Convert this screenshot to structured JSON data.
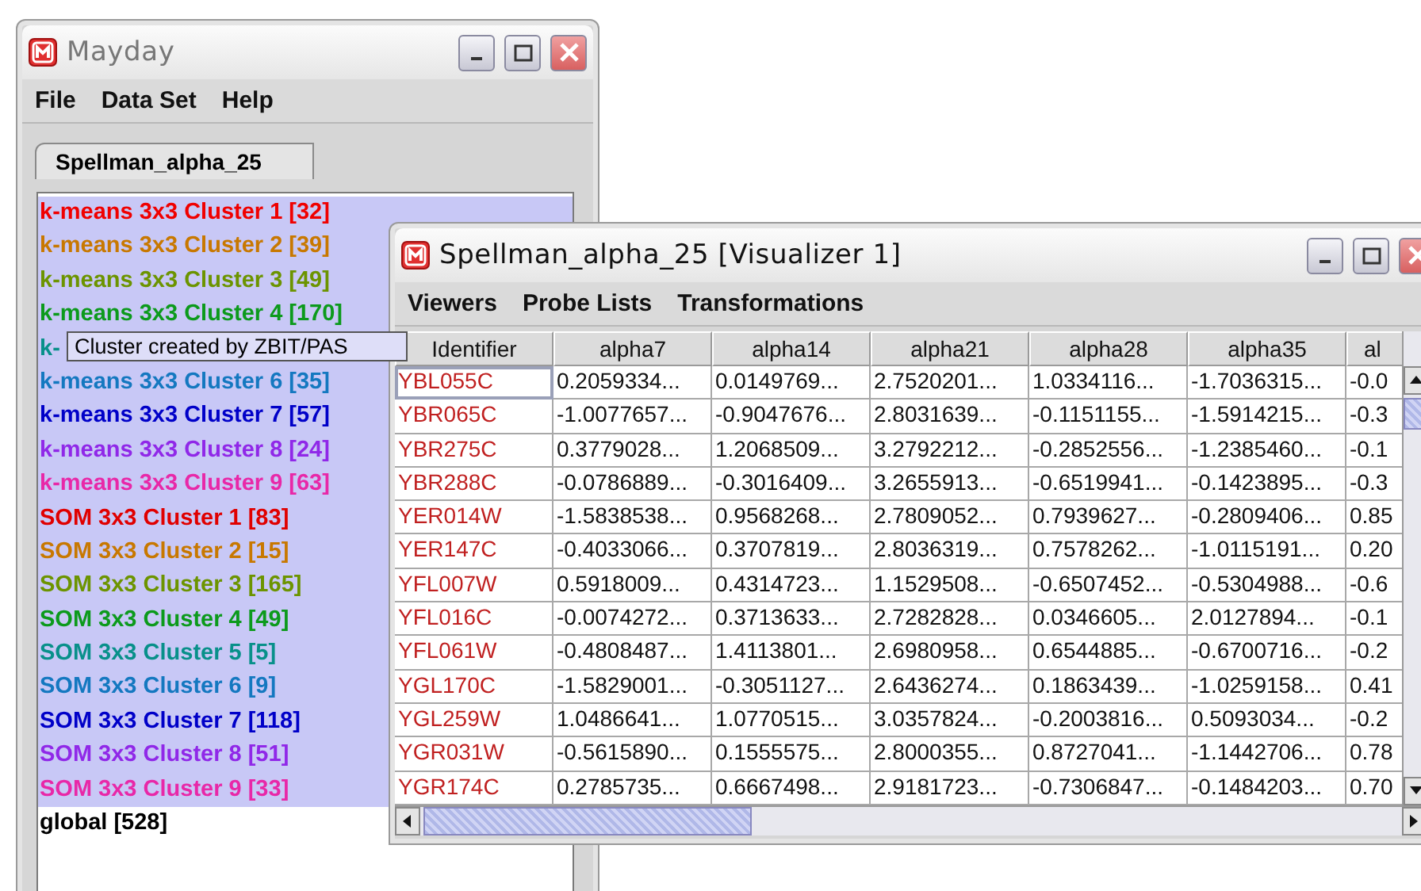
{
  "main_window": {
    "title": "Mayday",
    "active": false,
    "menu": [
      "File",
      "Data Set",
      "Help"
    ],
    "tabs": [
      {
        "label": "Spellman_alpha_25",
        "selected": true
      }
    ],
    "clusters": [
      {
        "label": "k-means 3x3 Cluster 1 [32]",
        "color": "#f00000",
        "selected": true
      },
      {
        "label": "k-means 3x3 Cluster 2 [39]",
        "color": "#c87800",
        "selected": true
      },
      {
        "label": "k-means 3x3 Cluster 3 [49]",
        "color": "#6c9400",
        "selected": true
      },
      {
        "label": "k-means 3x3 Cluster 4 [170]",
        "color": "#0c9a1c",
        "selected": true
      },
      {
        "label": "k-",
        "color": "#08908a",
        "selected": true,
        "tooltip": "Cluster created by ZBIT/PAS"
      },
      {
        "label": "k-means 3x3 Cluster 6 [35]",
        "color": "#1478c0",
        "selected": true
      },
      {
        "label": "k-means 3x3 Cluster 7 [57]",
        "color": "#0000c8",
        "selected": true
      },
      {
        "label": "k-means 3x3 Cluster 8 [24]",
        "color": "#9028e8",
        "selected": true
      },
      {
        "label": "k-means 3x3 Cluster 9 [63]",
        "color": "#e828a8",
        "selected": true
      },
      {
        "label": "SOM 3x3 Cluster 1 [83]",
        "color": "#e00000",
        "selected": true
      },
      {
        "label": "SOM 3x3 Cluster 2 [15]",
        "color": "#c87800",
        "selected": true
      },
      {
        "label": "SOM 3x3 Cluster 3 [165]",
        "color": "#6c9400",
        "selected": true
      },
      {
        "label": "SOM 3x3 Cluster 4 [49]",
        "color": "#0c9a1c",
        "selected": true
      },
      {
        "label": "SOM 3x3 Cluster 5 [5]",
        "color": "#08908a",
        "selected": true
      },
      {
        "label": "SOM 3x3 Cluster 6 [9]",
        "color": "#1478c0",
        "selected": true
      },
      {
        "label": "SOM 3x3 Cluster 7 [118]",
        "color": "#0000c8",
        "selected": true
      },
      {
        "label": "SOM 3x3 Cluster 8 [51]",
        "color": "#9028e8",
        "selected": true
      },
      {
        "label": "SOM 3x3 Cluster 9 [33]",
        "color": "#e828a8",
        "selected": true
      },
      {
        "label": "global [528]",
        "color": "#000000",
        "selected": false
      }
    ]
  },
  "visualizer": {
    "title": "Spellman_alpha_25 [Visualizer 1]",
    "active": true,
    "menu": [
      "Viewers",
      "Probe Lists",
      "Transformations"
    ],
    "columns": [
      "Identifier",
      "alpha7",
      "alpha14",
      "alpha21",
      "alpha28",
      "alpha35",
      "al"
    ],
    "rows": [
      {
        "id": "YBL055C",
        "focused": true,
        "values": [
          "0.2059334...",
          "0.0149769...",
          "2.7520201...",
          "1.0334116...",
          "-1.7036315...",
          "-0.0"
        ]
      },
      {
        "id": "YBR065C",
        "focused": false,
        "values": [
          "-1.0077657...",
          "-0.9047676...",
          "2.8031639...",
          "-0.1151155...",
          "-1.5914215...",
          "-0.3"
        ]
      },
      {
        "id": "YBR275C",
        "focused": false,
        "values": [
          "0.3779028...",
          "1.2068509...",
          "3.2792212...",
          "-0.2852556...",
          "-1.2385460...",
          "-0.1"
        ]
      },
      {
        "id": "YBR288C",
        "focused": false,
        "values": [
          "-0.0786889...",
          "-0.3016409...",
          "3.2655913...",
          "-0.6519941...",
          "-0.1423895...",
          "-0.3"
        ]
      },
      {
        "id": "YER014W",
        "focused": false,
        "values": [
          "-1.5838538...",
          "0.9568268...",
          "2.7809052...",
          "0.7939627...",
          "-0.2809406...",
          "0.85"
        ]
      },
      {
        "id": "YER147C",
        "focused": false,
        "values": [
          "-0.4033066...",
          "0.3707819...",
          "2.8036319...",
          "0.7578262...",
          "-1.0115191...",
          "0.20"
        ]
      },
      {
        "id": "YFL007W",
        "focused": false,
        "values": [
          "0.5918009...",
          "0.4314723...",
          "1.1529508...",
          "-0.6507452...",
          "-0.5304988...",
          "-0.6"
        ]
      },
      {
        "id": "YFL016C",
        "focused": false,
        "values": [
          "-0.0074272...",
          "0.3713633...",
          "2.7282828...",
          "0.0346605...",
          "2.0127894...",
          "-0.1"
        ]
      },
      {
        "id": "YFL061W",
        "focused": false,
        "values": [
          "-0.4808487...",
          "1.4113801...",
          "2.6980958...",
          "0.6544885...",
          "-0.6700716...",
          "-0.2"
        ]
      },
      {
        "id": "YGL170C",
        "focused": false,
        "values": [
          "-1.5829001...",
          "-0.3051127...",
          "2.6436274...",
          "0.1863439...",
          "-1.0259158...",
          "0.41"
        ]
      },
      {
        "id": "YGL259W",
        "focused": false,
        "values": [
          "1.0486641...",
          "1.0770515...",
          "3.0357824...",
          "-0.2003816...",
          "0.5093034...",
          "-0.2"
        ]
      },
      {
        "id": "YGR031W",
        "focused": false,
        "values": [
          "-0.5615890...",
          "0.1555575...",
          "2.8000355...",
          "0.8727041...",
          "-1.1442706...",
          "0.78"
        ]
      },
      {
        "id": "YGR174C",
        "focused": false,
        "values": [
          "0.2785735...",
          "0.6667498...",
          "2.9181723...",
          "-0.7306847...",
          "-0.1484203...",
          "0.70"
        ]
      }
    ]
  }
}
